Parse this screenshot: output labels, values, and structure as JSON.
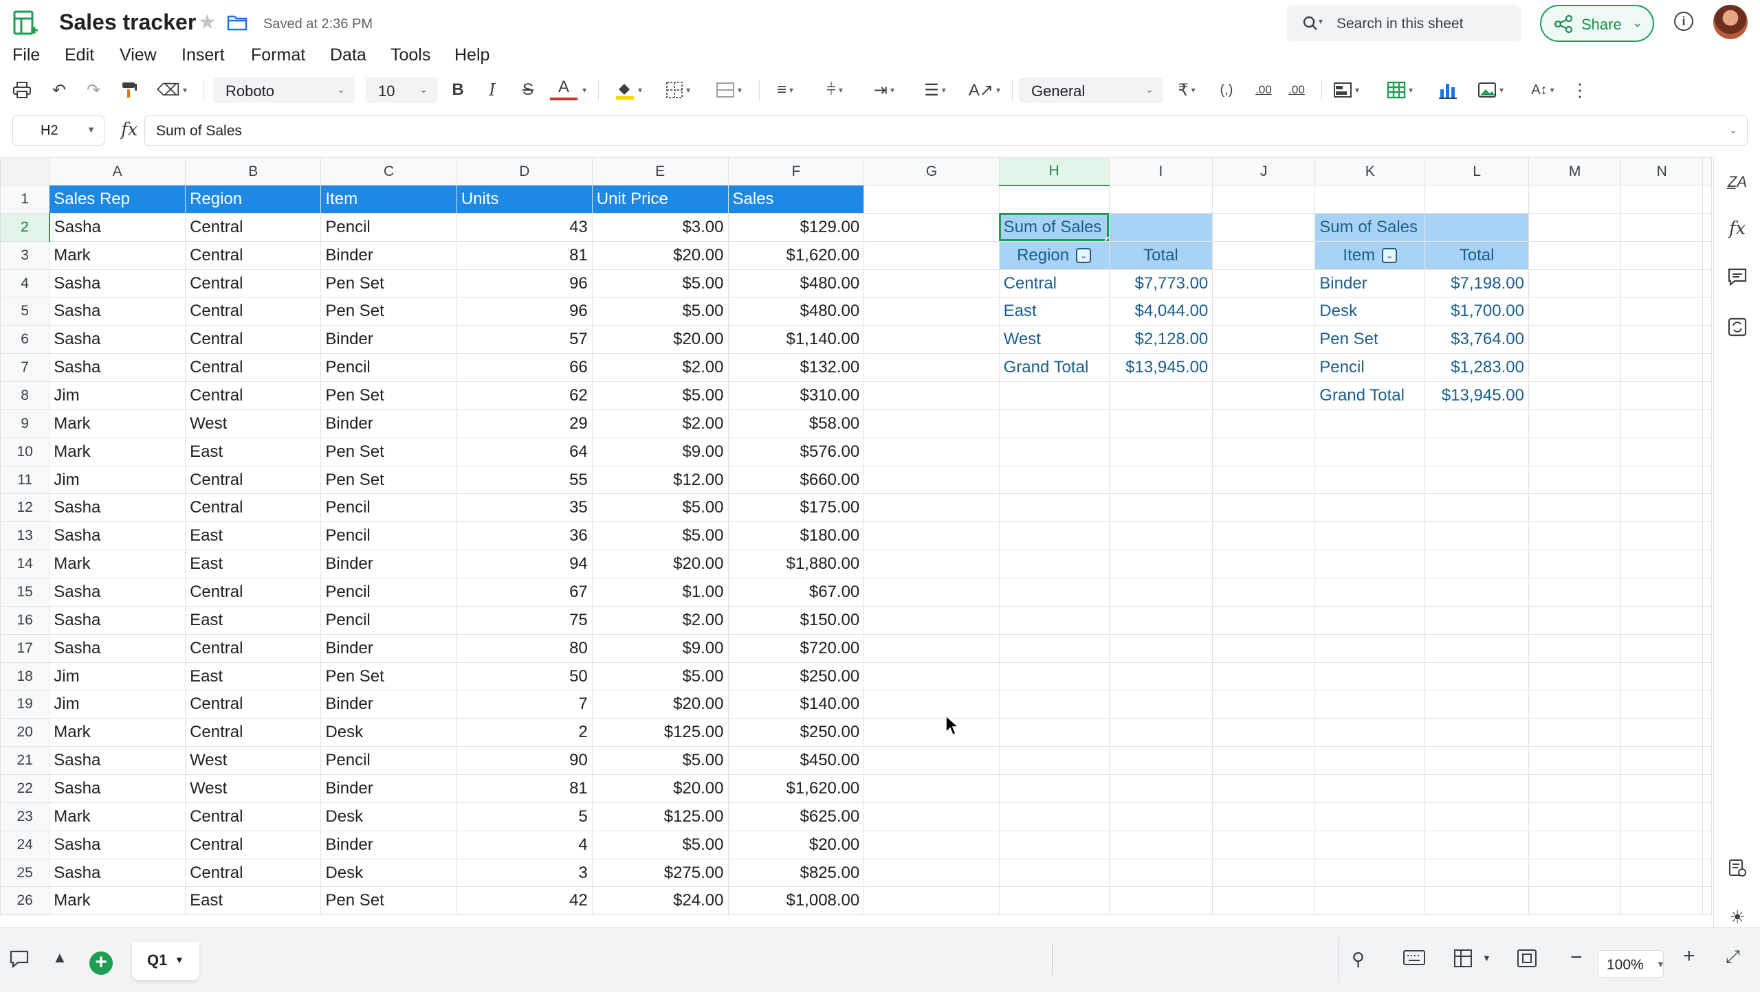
{
  "app": {
    "title": "Sales tracker",
    "saved_status": "Saved at 2:36 PM",
    "search_placeholder": "Search in this sheet",
    "share_label": "Share",
    "accent_color": "#1e9e55",
    "header_fill_color": "#1e88e5",
    "pivot_header_color": "#a9d3f5"
  },
  "menu": [
    "File",
    "Edit",
    "View",
    "Insert",
    "Format",
    "Data",
    "Tools",
    "Help"
  ],
  "toolbar": {
    "font_name": "Roboto",
    "font_size": "10",
    "number_format": "General",
    "bold": "B",
    "italic": "I",
    "strike": "S",
    "text_color_glyph": "A",
    "currency": "₹",
    "paren": "(,)",
    "dec_decrease": ".00",
    "dec_increase": ".00"
  },
  "formula_bar": {
    "cell_ref": "H2",
    "fx_label": "fx",
    "content": "Sum of Sales"
  },
  "columns": [
    "A",
    "B",
    "C",
    "D",
    "E",
    "F",
    "G",
    "H",
    "I",
    "J",
    "K",
    "L",
    "M",
    "N"
  ],
  "rows": [
    "1",
    "2",
    "3",
    "4",
    "5",
    "6",
    "7",
    "8",
    "9",
    "10",
    "11",
    "12",
    "13",
    "14",
    "15",
    "16",
    "17",
    "18",
    "19",
    "20",
    "21",
    "22",
    "23",
    "24",
    "25",
    "26"
  ],
  "data_table": {
    "headers": [
      "Sales Rep",
      "Region",
      "Item",
      "Units",
      "Unit Price",
      "Sales"
    ],
    "rows": [
      [
        "Sasha",
        "Central",
        "Pencil",
        "43",
        "$3.00",
        "$129.00"
      ],
      [
        "Mark",
        "Central",
        "Binder",
        "81",
        "$20.00",
        "$1,620.00"
      ],
      [
        "Sasha",
        "Central",
        "Pen Set",
        "96",
        "$5.00",
        "$480.00"
      ],
      [
        "Sasha",
        "Central",
        "Pen Set",
        "96",
        "$5.00",
        "$480.00"
      ],
      [
        "Sasha",
        "Central",
        "Binder",
        "57",
        "$20.00",
        "$1,140.00"
      ],
      [
        "Sasha",
        "Central",
        "Pencil",
        "66",
        "$2.00",
        "$132.00"
      ],
      [
        "Jim",
        "Central",
        "Pen Set",
        "62",
        "$5.00",
        "$310.00"
      ],
      [
        "Mark",
        "West",
        "Binder",
        "29",
        "$2.00",
        "$58.00"
      ],
      [
        "Mark",
        "East",
        "Pen Set",
        "64",
        "$9.00",
        "$576.00"
      ],
      [
        "Jim",
        "Central",
        "Pen Set",
        "55",
        "$12.00",
        "$660.00"
      ],
      [
        "Sasha",
        "Central",
        "Pencil",
        "35",
        "$5.00",
        "$175.00"
      ],
      [
        "Sasha",
        "East",
        "Pencil",
        "36",
        "$5.00",
        "$180.00"
      ],
      [
        "Mark",
        "East",
        "Binder",
        "94",
        "$20.00",
        "$1,880.00"
      ],
      [
        "Sasha",
        "Central",
        "Pencil",
        "67",
        "$1.00",
        "$67.00"
      ],
      [
        "Sasha",
        "East",
        "Pencil",
        "75",
        "$2.00",
        "$150.00"
      ],
      [
        "Sasha",
        "Central",
        "Binder",
        "80",
        "$9.00",
        "$720.00"
      ],
      [
        "Jim",
        "East",
        "Pen Set",
        "50",
        "$5.00",
        "$250.00"
      ],
      [
        "Jim",
        "Central",
        "Binder",
        "7",
        "$20.00",
        "$140.00"
      ],
      [
        "Mark",
        "Central",
        "Desk",
        "2",
        "$125.00",
        "$250.00"
      ],
      [
        "Sasha",
        "West",
        "Pencil",
        "90",
        "$5.00",
        "$450.00"
      ],
      [
        "Sasha",
        "West",
        "Binder",
        "81",
        "$20.00",
        "$1,620.00"
      ],
      [
        "Mark",
        "Central",
        "Desk",
        "5",
        "$125.00",
        "$625.00"
      ],
      [
        "Sasha",
        "Central",
        "Binder",
        "4",
        "$5.00",
        "$20.00"
      ],
      [
        "Sasha",
        "Central",
        "Desk",
        "3",
        "$275.00",
        "$825.00"
      ],
      [
        "Mark",
        "East",
        "Pen Set",
        "42",
        "$24.00",
        "$1,008.00"
      ]
    ]
  },
  "pivot_region": {
    "title": "Sum of Sales",
    "row_label": "Region",
    "value_label": "Total",
    "rows": [
      [
        "Central",
        "$7,773.00"
      ],
      [
        "East",
        "$4,044.00"
      ],
      [
        "West",
        "$2,128.00"
      ]
    ],
    "grand_total_label": "Grand Total",
    "grand_total": "$13,945.00"
  },
  "pivot_item": {
    "title": "Sum of Sales",
    "row_label": "Item",
    "value_label": "Total",
    "rows": [
      [
        "Binder",
        "$7,198.00"
      ],
      [
        "Desk",
        "$1,700.00"
      ],
      [
        "Pen Set",
        "$3,764.00"
      ],
      [
        "Pencil",
        "$1,283.00"
      ]
    ],
    "grand_total_label": "Grand Total",
    "grand_total": "$13,945.00"
  },
  "bottom_bar": {
    "sheet_tab": "Q1",
    "zoom": "100%"
  }
}
